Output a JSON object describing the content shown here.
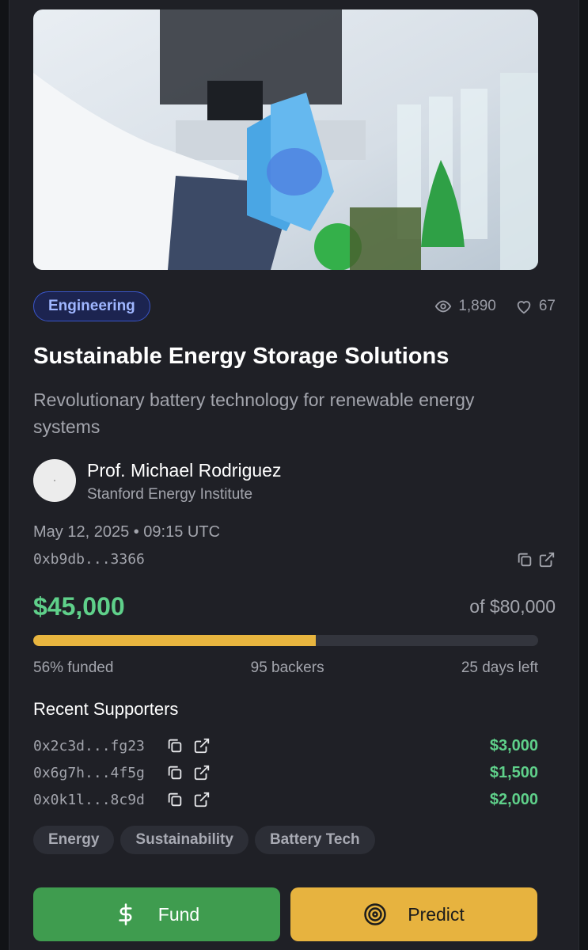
{
  "project": {
    "category": "Engineering",
    "views": "1,890",
    "likes": "67",
    "title": "Sustainable Energy Storage Solutions",
    "description": "Revolutionary battery technology for renewable energy systems",
    "author_name": "Prof. Michael Rodriguez",
    "author_org": "Stanford Energy Institute",
    "date": "May 12, 2025 • 09:15 UTC",
    "tx_hash": "0xb9db...3366"
  },
  "funding": {
    "raised": "$45,000",
    "goal": "of $80,000",
    "progress_fraction": 0.56,
    "percent_label": "56% funded",
    "backers_label": "95 backers",
    "days_left_label": "25 days left"
  },
  "supporters": {
    "title": "Recent Supporters",
    "items": [
      {
        "address": "0x2c3d...fg23",
        "amount": "$3,000"
      },
      {
        "address": "0x6g7h...4f5g",
        "amount": "$1,500"
      },
      {
        "address": "0x0k1l...8c9d",
        "amount": "$2,000"
      }
    ]
  },
  "tags": [
    "Energy",
    "Sustainability",
    "Battery Tech"
  ],
  "actions": {
    "fund_label": "Fund",
    "predict_label": "Predict"
  },
  "icons": {
    "views": "eye-icon",
    "likes": "heart-icon",
    "copy": "copy-icon",
    "external": "external-link-icon",
    "fund": "dollar-icon",
    "predict": "target-icon"
  },
  "colors": {
    "accent_green": "#5fd08a",
    "progress": "#e8b53f",
    "fund_button": "#3f9c4f",
    "predict_button": "#e7b33f",
    "category_badge": "#3a55c8"
  }
}
